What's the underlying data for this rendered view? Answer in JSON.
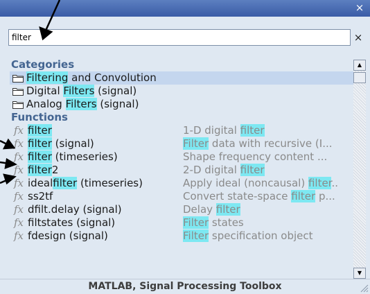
{
  "search": {
    "value": "filter"
  },
  "categories_header": "Categories",
  "categories": [
    {
      "label": "Filtering and Convolution",
      "parts": [
        "",
        "Filtering",
        " and Convolution"
      ],
      "selected": true
    },
    {
      "label": "Digital Filters (signal)",
      "parts": [
        "Digital ",
        "Filters",
        " (signal)"
      ],
      "selected": false
    },
    {
      "label": "Analog Filters (signal)",
      "parts": [
        "Analog ",
        "Filters",
        " (signal)"
      ],
      "selected": false
    }
  ],
  "functions_header": "Functions",
  "functions": [
    {
      "name": [
        "",
        "filter",
        ""
      ],
      "desc": [
        "1-D digital ",
        "filter",
        ""
      ]
    },
    {
      "name": [
        "",
        "filter",
        " (signal)"
      ],
      "desc": [
        "",
        "Filter",
        " data with recursive (I..."
      ]
    },
    {
      "name": [
        "",
        "filter",
        " (timeseries)"
      ],
      "desc": [
        "Shape frequency content ...",
        "",
        ""
      ]
    },
    {
      "name": [
        "",
        "filter",
        "2"
      ],
      "desc": [
        "2-D digital ",
        "filter",
        ""
      ]
    },
    {
      "name": [
        "ideal",
        "filter",
        " (timeseries)"
      ],
      "desc": [
        "Apply ideal (noncausal) ",
        "filter",
        ".."
      ]
    },
    {
      "name": [
        "ss2tf",
        "",
        ""
      ],
      "desc": [
        "Convert state-space ",
        "filter",
        " p..."
      ]
    },
    {
      "name": [
        "dfilt.delay (signal)",
        "",
        ""
      ],
      "desc": [
        "Delay ",
        "filter",
        ""
      ]
    },
    {
      "name": [
        "filtstates (signal)",
        "",
        ""
      ],
      "desc": [
        "",
        "Filter",
        " states"
      ]
    },
    {
      "name": [
        "fdesign (signal)",
        "",
        ""
      ],
      "desc": [
        "",
        "Filter",
        " specification object"
      ]
    }
  ],
  "footer": "MATLAB, Signal Processing Toolbox",
  "icons": {
    "title_close": "close-icon",
    "search_clear": "clear-icon",
    "folder": "folder-icon",
    "function": "fx-icon"
  },
  "glyphs": {
    "close": "×",
    "fx": "fx",
    "scroll_up": "▲",
    "scroll_down": "▼"
  },
  "colors": {
    "highlight": "#7de8f2",
    "selected_row": "#c4d6ee",
    "header_text": "#446591",
    "titlebar": "#4a6db3"
  }
}
